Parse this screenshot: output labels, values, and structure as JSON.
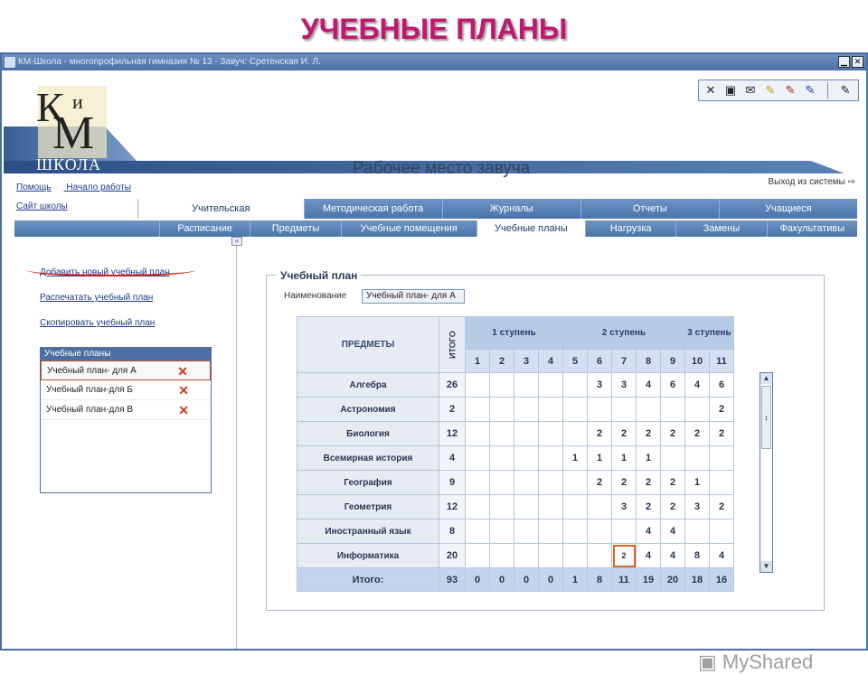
{
  "slide_title": "УЧЕБНЫЕ ПЛАНЫ",
  "window": {
    "title": "КМ-Школа - многопрофильная гимназия № 13 - Завуч: Сретенская И. Л.",
    "min": "▁",
    "close": "✕"
  },
  "logo": {
    "k": "К",
    "i": "и",
    "m": "М",
    "school": "ШКОЛА"
  },
  "workplace": "Рабочее место завуча",
  "top_links": {
    "help": "Помощь",
    "start": "Начало работы",
    "site": "Сайт школы"
  },
  "logout": "Выход из системы",
  "main_tabs": [
    "Учительская",
    "Методическая работа",
    "Журналы",
    "Отчеты",
    "Учащиеся"
  ],
  "sub_tabs": [
    "Расписание",
    "Предметы",
    "Учебные помещения",
    "Учебные планы",
    "Нагрузка",
    "Замены",
    "Факультативы"
  ],
  "actions": [
    "Добавить новый учебный план",
    "Распечатать учебный план",
    "Скопировать учебный план"
  ],
  "plans": {
    "header": "Учебные планы",
    "items": [
      "Учебный план- для А",
      "Учебный план-для Б",
      "Учебный план-для В"
    ]
  },
  "form": {
    "legend": "Учебный план",
    "name_label": "Наименование",
    "name_value": "Учебный план- для А"
  },
  "table": {
    "subjects_header": "ПРЕДМЕТЫ",
    "total_header": "ИТОГО",
    "stages": [
      "1 ступень",
      "2 ступень",
      "3 ступень"
    ],
    "grades": [
      "1",
      "2",
      "3",
      "4",
      "5",
      "6",
      "7",
      "8",
      "9",
      "10",
      "11"
    ],
    "rows": [
      {
        "name": "Алгебра",
        "total": "26",
        "cells": [
          "",
          "",
          "",
          "",
          "",
          "3",
          "3",
          "4",
          "6",
          "4",
          "6"
        ]
      },
      {
        "name": "Астрономия",
        "total": "2",
        "cells": [
          "",
          "",
          "",
          "",
          "",
          "",
          "",
          "",
          "",
          "",
          "2"
        ]
      },
      {
        "name": "Биология",
        "total": "12",
        "cells": [
          "",
          "",
          "",
          "",
          "",
          "2",
          "2",
          "2",
          "2",
          "2",
          "2"
        ]
      },
      {
        "name": "Всемирная история",
        "total": "4",
        "cells": [
          "",
          "",
          "",
          "",
          "1",
          "1",
          "1",
          "1",
          "",
          "",
          ""
        ]
      },
      {
        "name": "География",
        "total": "9",
        "cells": [
          "",
          "",
          "",
          "",
          "",
          "2",
          "2",
          "2",
          "2",
          "1",
          ""
        ]
      },
      {
        "name": "Геометрия",
        "total": "12",
        "cells": [
          "",
          "",
          "",
          "",
          "",
          "",
          "3",
          "2",
          "2",
          "3",
          "2"
        ]
      },
      {
        "name": "Иностранный язык",
        "total": "8",
        "cells": [
          "",
          "",
          "",
          "",
          "",
          "",
          "",
          "4",
          "4",
          "",
          ""
        ]
      },
      {
        "name": "Информатика",
        "total": "20",
        "cells": [
          "",
          "",
          "",
          "",
          "",
          "",
          "2",
          "4",
          "4",
          "8",
          "4"
        ]
      }
    ],
    "sum": {
      "name": "Итого:",
      "total": "93",
      "cells": [
        "0",
        "0",
        "0",
        "0",
        "1",
        "8",
        "11",
        "19",
        "20",
        "18",
        "16"
      ]
    }
  },
  "watermark": "MyShared"
}
